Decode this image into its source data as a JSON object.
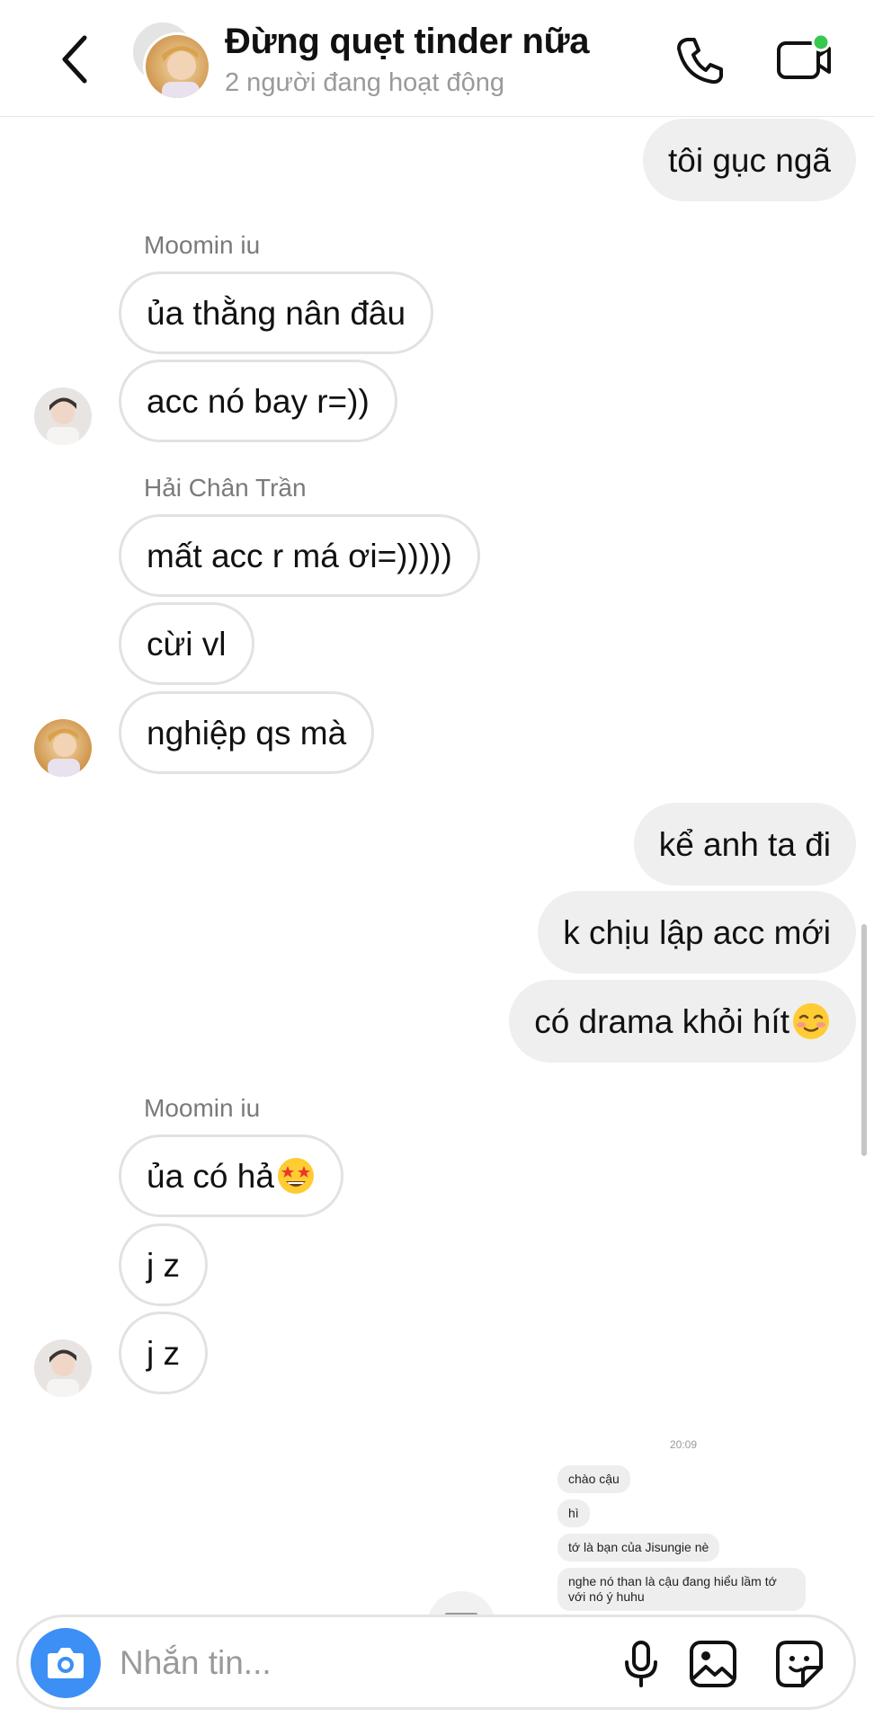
{
  "header": {
    "title": "Đừng quẹt tinder nữa",
    "subtitle": "2 người đang hoạt động",
    "icons": [
      "chevron-left-icon",
      "phone-icon",
      "video-camera-icon"
    ],
    "online_color": "#36c94f"
  },
  "messages": [
    {
      "side": "out",
      "text": "tôi gục ngã"
    },
    {
      "sender": "Moomin iu"
    },
    {
      "side": "in",
      "text": "ủa thằng nân đâu"
    },
    {
      "side": "in",
      "text": "acc nó bay r=))"
    },
    {
      "sender": "Hải Chân Trần"
    },
    {
      "side": "in",
      "text": "mất acc r má ơi=)))))"
    },
    {
      "side": "in",
      "text": "cừi vl"
    },
    {
      "side": "in",
      "text": "nghiệp qs mà"
    },
    {
      "side": "out",
      "text": "kể anh ta đi"
    },
    {
      "side": "out",
      "text": "k chịu lập acc mới"
    },
    {
      "side": "out",
      "text": "có drama khỏi hít",
      "emoji": "smiling-blush-emoji"
    },
    {
      "sender": "Moomin iu"
    },
    {
      "side": "in",
      "text": "ủa có hả",
      "emoji": "star-struck-emoji"
    },
    {
      "side": "in",
      "text": "j z"
    },
    {
      "side": "in",
      "text": "j z"
    }
  ],
  "shared_screenshot": {
    "time": "20:09",
    "lines": [
      "chào cậu",
      "hì",
      "tớ là bạn của Jisungie nè",
      "nghe nó than là cậu đang hiểu lầm tớ",
      "với nó ý huhu"
    ]
  },
  "composer": {
    "placeholder": "Nhắn tin...",
    "accent_color": "#3c8ff5",
    "icons": [
      "camera-icon",
      "microphone-icon",
      "gallery-icon",
      "sticker-icon"
    ]
  }
}
